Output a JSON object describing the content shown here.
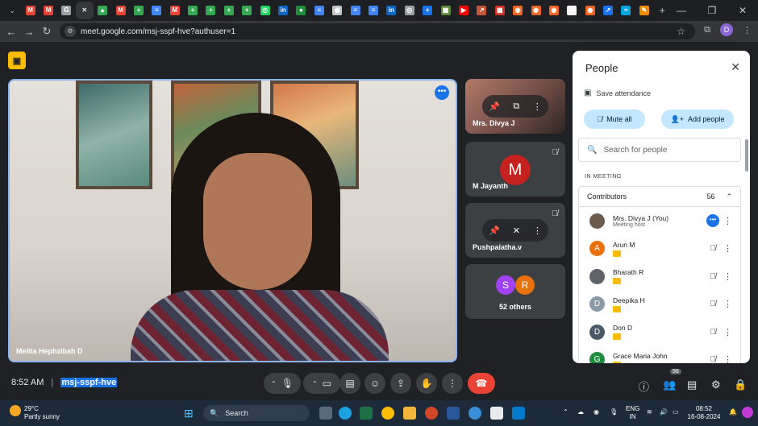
{
  "browser": {
    "url": "meet.google.com/msj-sspf-hve?authuser=1",
    "profile_initial": "D",
    "site_icon": "tune-icon",
    "tab_favicons": [
      {
        "label": "M",
        "color": "#ea4335"
      },
      {
        "label": "M",
        "color": "#ea4335"
      },
      {
        "label": "G",
        "color": "#9aa0a6"
      },
      {
        "label": "✕",
        "color": "#35363a"
      },
      {
        "label": "▲",
        "color": "#34a853"
      },
      {
        "label": "M",
        "color": "#ea4335"
      },
      {
        "label": "+",
        "color": "#34a853"
      },
      {
        "label": "≡",
        "color": "#4285f4"
      },
      {
        "label": "M",
        "color": "#ea4335"
      },
      {
        "label": "+",
        "color": "#34a853"
      },
      {
        "label": "+",
        "color": "#34a853"
      },
      {
        "label": "+",
        "color": "#34a853"
      },
      {
        "label": "+",
        "color": "#34a853"
      },
      {
        "label": "◎",
        "color": "#25d366"
      },
      {
        "label": "in",
        "color": "#0a66c2"
      },
      {
        "label": "●",
        "color": "#1e8e3e"
      },
      {
        "label": "≡",
        "color": "#4285f4"
      },
      {
        "label": "◉",
        "color": "#c4c7c5"
      },
      {
        "label": "≡",
        "color": "#4285f4"
      },
      {
        "label": "≡",
        "color": "#4285f4"
      },
      {
        "label": "in",
        "color": "#0a66c2"
      },
      {
        "label": "◎",
        "color": "#9aa0a6"
      },
      {
        "label": "+",
        "color": "#1a73e8"
      },
      {
        "label": "▦",
        "color": "#5f8a3a"
      },
      {
        "label": "▶",
        "color": "#ff0000"
      },
      {
        "label": "↗",
        "color": "#c4573a"
      },
      {
        "label": "▦",
        "color": "#d93025"
      },
      {
        "label": "◉",
        "color": "#f26522"
      },
      {
        "label": "◉",
        "color": "#f26522"
      },
      {
        "label": "◉",
        "color": "#f26522"
      },
      {
        "label": "●",
        "color": "#f5f5f5"
      },
      {
        "label": "◉",
        "color": "#f26522"
      },
      {
        "label": "↗",
        "color": "#1a73e8"
      },
      {
        "label": "≈",
        "color": "#00a3e0"
      },
      {
        "label": "✎",
        "color": "#f28b00"
      }
    ]
  },
  "meet": {
    "main_participant": "Melita Hephzibah D",
    "tiles": [
      {
        "name": "Mrs. Divya J",
        "initial": ""
      },
      {
        "name": "M Jayanth",
        "initial": "M",
        "color": "#c5221f"
      },
      {
        "name": "Pushpalatha.v",
        "initial": ""
      }
    ],
    "others": {
      "label": "52 others",
      "avatars": [
        {
          "initial": "S",
          "color": "#a142f4"
        },
        {
          "initial": "R",
          "color": "#e8710a"
        }
      ]
    },
    "time": "8:52 AM",
    "separator": "|",
    "meeting_code": "msj-sspf-hve",
    "participant_count": "56"
  },
  "people_panel": {
    "title": "People",
    "save_attendance": "Save attendance",
    "mute_all": "Mute all",
    "add_people": "Add people",
    "search_placeholder": "Search for people",
    "section_label": "IN MEETING",
    "contributors_label": "Contributors",
    "contributors_count": "56",
    "participants": [
      {
        "name": "Mrs. Divya J (You)",
        "sub": "Meeting host",
        "initial": "",
        "color": "#6b5b4e"
      },
      {
        "name": "Arun M",
        "sub": "",
        "initial": "A",
        "color": "#e8710a"
      },
      {
        "name": "Bharath R",
        "sub": "",
        "initial": "",
        "color": "#5f6368"
      },
      {
        "name": "Deepika H",
        "sub": "",
        "initial": "D",
        "color": "#8a9ba8"
      },
      {
        "name": "Don D",
        "sub": "",
        "initial": "D",
        "color": "#4a5a68"
      },
      {
        "name": "Grace Maria John",
        "sub": "",
        "initial": "G",
        "color": "#1e8e3e"
      }
    ]
  },
  "taskbar": {
    "temperature": "29°C",
    "weather": "Partly sunny",
    "search": "Search",
    "language": "ENG",
    "region": "IN",
    "time": "08:52",
    "date": "16-08-2024"
  }
}
